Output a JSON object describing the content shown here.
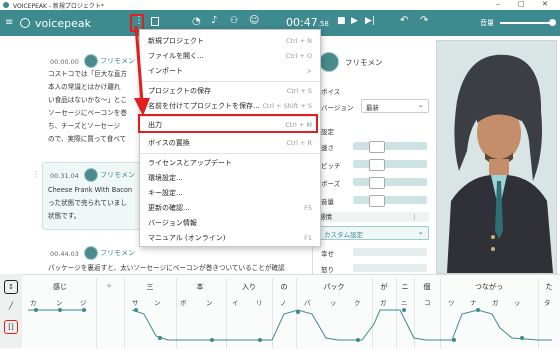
{
  "window": {
    "title": "VOICEPEAK - 新規プロジェクト*",
    "min": "–",
    "max": "□",
    "close": "✕"
  },
  "app": {
    "brand": "voicepeak",
    "time_main": "00:47",
    "time_ms": ".58",
    "volume_label": "音量",
    "volume_level": 0.9
  },
  "menu_items": [
    {
      "label": "新規プロジェクト",
      "shortcut": "Ctrl + N"
    },
    {
      "label": "ファイルを開く...",
      "shortcut": "Ctrl + O"
    },
    {
      "label": "インポート",
      "shortcut": ">"
    },
    {
      "label": "プロジェクトの保存",
      "shortcut": "Ctrl + S"
    },
    {
      "label": "名前を付けてプロジェクトを保存...",
      "shortcut": "Ctrl + Shift + S"
    },
    {
      "label": "出力",
      "shortcut": "Ctrl + M"
    },
    {
      "label": "ボイスの置換",
      "shortcut": "Ctrl + R"
    },
    {
      "label": "ライセンスとアップデート",
      "shortcut": ""
    },
    {
      "label": "環境設定...",
      "shortcut": ""
    },
    {
      "label": "キー設定...",
      "shortcut": ""
    },
    {
      "label": "更新の確認...",
      "shortcut": "F5"
    },
    {
      "label": "バージョン情報",
      "shortcut": ""
    },
    {
      "label": "マニュアル (オンライン)",
      "shortcut": "F1"
    }
  ],
  "blocks": [
    {
      "time": "00.00.00",
      "speaker": "フリモメン",
      "lines": [
        "コストコでは「巨大な直方",
        "本人の常識とはかけ離れ",
        "い食品はないかな～」とこ",
        "ソーセージにベーコンを巻",
        "ち、チーズとソーセージ",
        "ので、実際に買って食べて"
      ]
    },
    {
      "time": "00.31.04",
      "speaker": "フリモメン",
      "lines": [
        "Cheese Frank With Bacon",
        "った状態で売られていまし",
        "状態です。"
      ]
    },
    {
      "time": "00.44.03",
      "speaker": "フリモメン",
      "lines": [
        "パッケージを裏返すと、太いソーセージにベーコンが巻きついていることが確認"
      ]
    }
  ],
  "panel": {
    "speaker": "フリモメン",
    "voice_label": "ボイス",
    "version_label": "バージョン",
    "version_value": "最新",
    "settings_label": "設定",
    "sliders": [
      {
        "label": "速さ",
        "value": 0.35
      },
      {
        "label": "ピッチ",
        "value": 0.35
      },
      {
        "label": "ポーズ",
        "value": 0.35
      },
      {
        "label": "音量",
        "value": 0.35
      }
    ],
    "emotion_label": "感情",
    "emotion_select": "カスタム設定",
    "emotions": [
      {
        "label": "幸せ",
        "value": 0.0
      },
      {
        "label": "怒り",
        "value": 0.0
      }
    ]
  },
  "timeline": {
    "words": [
      "感じ",
      "+",
      "三",
      "本",
      "入り",
      "の",
      "パック",
      "が",
      "ニ",
      "個",
      "つながっ",
      "た"
    ],
    "kana": [
      "カ",
      "ン",
      "ジ",
      "サ",
      "ン",
      "ボ",
      "ン",
      "イ",
      "リ",
      "ノ",
      "パ",
      "ッ",
      "ク",
      "ガ",
      "ニ",
      "コ",
      "ツ",
      "ナ",
      "ガ",
      "ッ",
      "タ"
    ]
  },
  "colors": {
    "accent": "#3d8a8f",
    "highlight": "#e02020"
  }
}
